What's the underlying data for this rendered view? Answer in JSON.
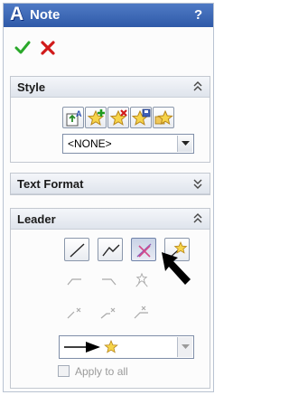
{
  "window": {
    "title": "Note",
    "help_label": "?"
  },
  "actions": {
    "ok": "ok-checkmark",
    "cancel": "cancel-x"
  },
  "style_group": {
    "title": "Style",
    "buttons": [
      "apply-style-icon",
      "add-style-icon",
      "delete-style-icon",
      "save-style-icon",
      "load-style-icon"
    ],
    "select_value": "<NONE>"
  },
  "text_format_group": {
    "title": "Text Format"
  },
  "leader_group": {
    "title": "Leader",
    "leader_buttons": [
      "leader-straight",
      "leader-bent",
      "no-leader",
      "auto-leader"
    ],
    "selected_leader": "no-leader",
    "arrow_style": "filled-arrow-with-balloon",
    "apply_to_all_label": "Apply to all"
  },
  "colors": {
    "title_bar": "#2f5aa8",
    "accent_green": "#2aa82a",
    "accent_red": "#d11a1a"
  }
}
